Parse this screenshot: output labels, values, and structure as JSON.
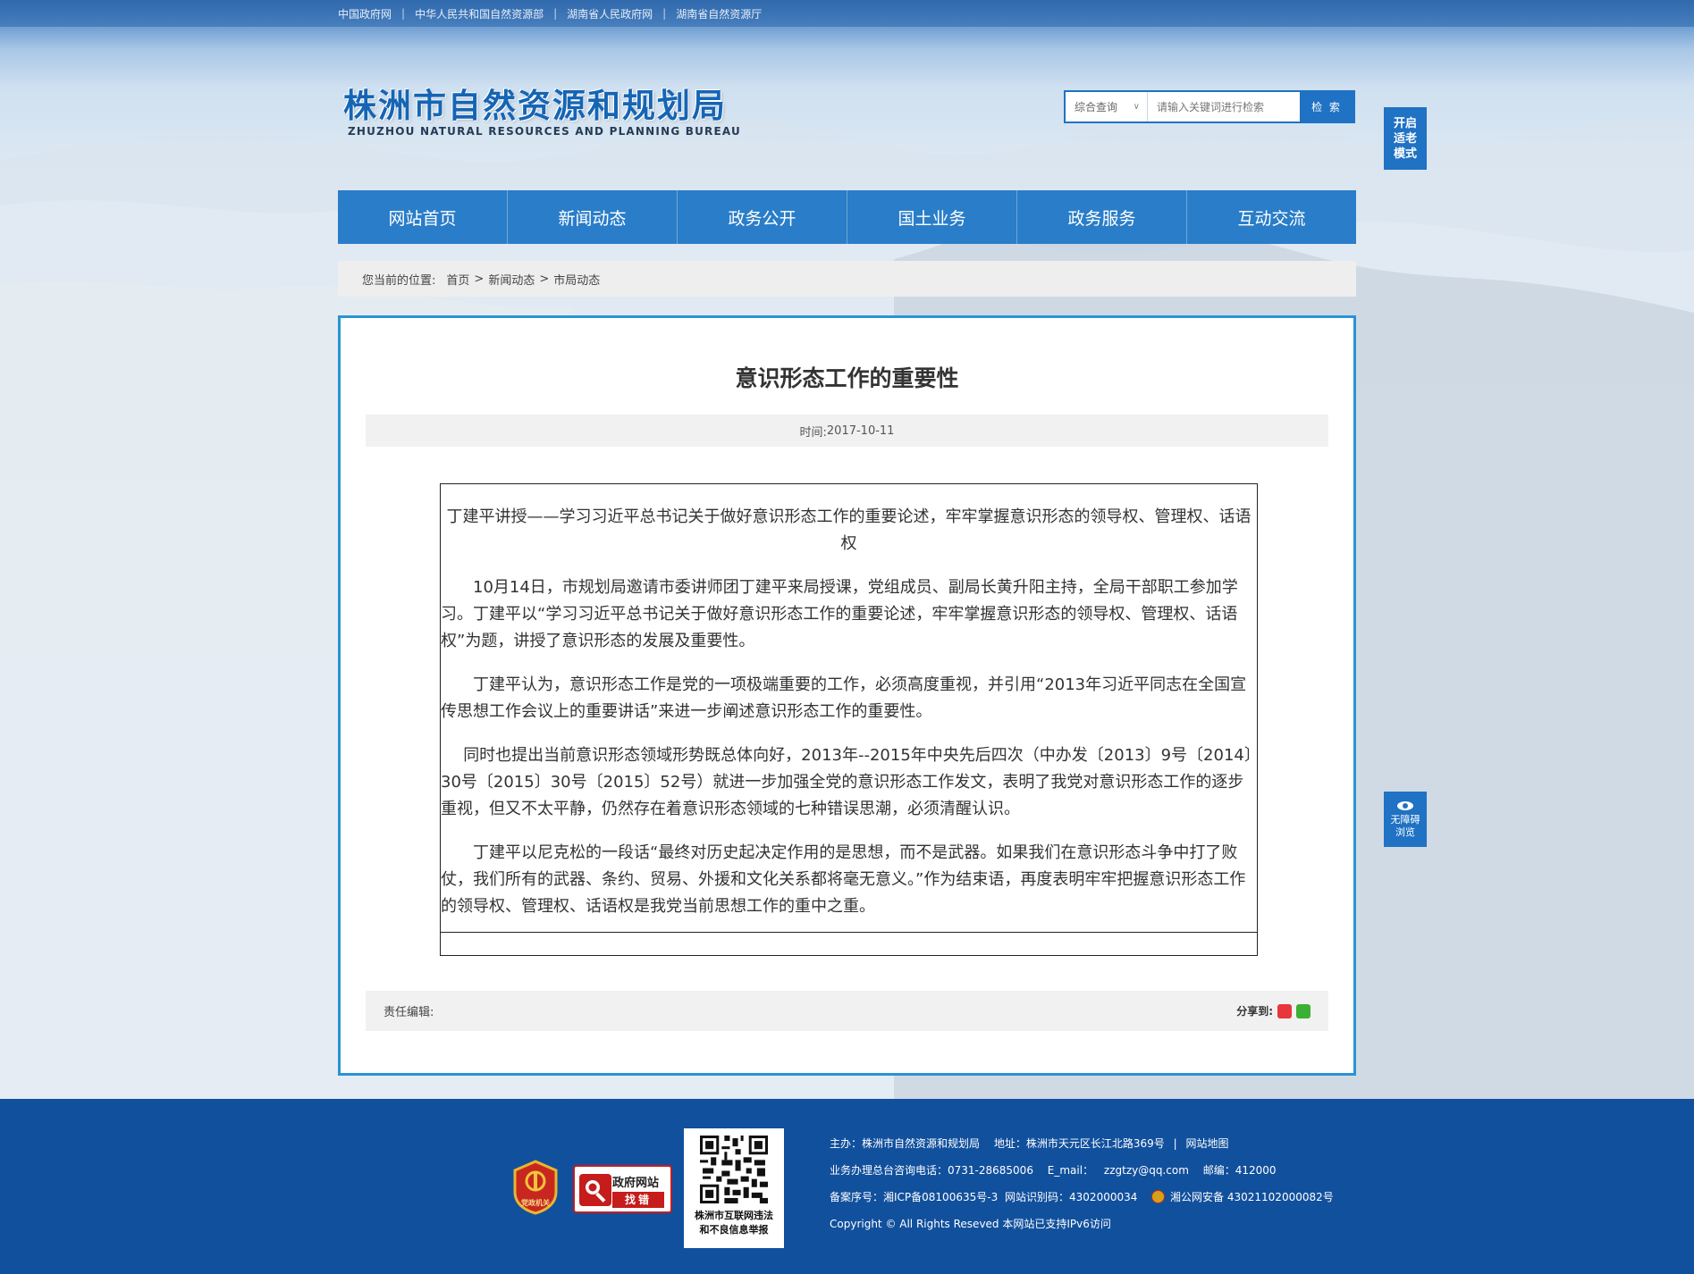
{
  "top_links": [
    "中国政府网",
    "中华人民共和国自然资源部",
    "湖南省人民政府网",
    "湖南省自然资源厅"
  ],
  "logo": {
    "cn": "株洲市自然资源和规划局",
    "en": "ZHUZHOU NATURAL RESOURCES AND PLANNING BUREAU"
  },
  "search": {
    "scope": "综合查询",
    "placeholder": "请输入关键词进行检索",
    "button": "检 索"
  },
  "side": {
    "elder_mode": [
      "开启",
      "适老",
      "模式"
    ],
    "accessibility": [
      "无障碍",
      "浏览"
    ]
  },
  "nav": [
    "网站首页",
    "新闻动态",
    "政务公开",
    "国土业务",
    "政务服务",
    "互动交流"
  ],
  "breadcrumb": {
    "label": "您当前的位置:",
    "items": [
      "首页",
      "新闻动态",
      "市局动态"
    ],
    "sep": ">"
  },
  "article": {
    "title": "意识形态工作的重要性",
    "date_label": "时间:",
    "date": "2017-10-11",
    "paragraphs": [
      "丁建平讲授——学习习近平总书记关于做好意识形态工作的重要论述，牢牢掌握意识形态的领导权、管理权、话语权",
      "10月14日，市规划局邀请市委讲师团丁建平来局授课，党组成员、副局长黄升阳主持，全局干部职工参加学习。丁建平以“学习习近平总书记关于做好意识形态工作的重要论述，牢牢掌握意识形态的领导权、管理权、话语权”为题，讲授了意识形态的发展及重要性。",
      "丁建平认为，意识形态工作是党的一项极端重要的工作，必须高度重视，并引用“2013年习近平同志在全国宣传思想工作会议上的重要讲话”来进一步阐述意识形态工作的重要性。",
      "同时也提出当前意识形态领域形势既总体向好，2013年--2015年中央先后四次（中办发〔2013〕9号〔2014〕30号〔2015〕30号〔2015〕52号）就进一步加强全党的意识形态工作发文，表明了我党对意识形态工作的逐步重视，但又不太平静，仍然存在着意识形态领域的七种错误思潮，必须清醒认识。",
      "丁建平以尼克松的一段话“最终对历史起决定作用的是思想，而不是武器。如果我们在意识形态斗争中打了败仗，我们所有的武器、条约、贸易、外援和文化关系都将毫无意义。”作为结束语，再度表明牢牢把握意识形态工作的领导权、管理权、话语权是我党当前思想工作的重中之重。"
    ],
    "editor_label": "责任编辑:",
    "share_label": "分享到:"
  },
  "footer": {
    "party_badge": "党政机关",
    "error_badge": {
      "line1": "政府网站",
      "line2": "找错"
    },
    "qr_caption": [
      "株洲市互联网违法",
      "和不良信息举报"
    ],
    "host": "主办：株洲市自然资源和规划局",
    "address": "地址：株洲市天元区长江北路369号",
    "sitemap": "网站地图",
    "hotline": "业务办理总台咨询电话：0731-28685006",
    "email_label": "E_mail：",
    "email": "zzgtzy@qq.com",
    "postcode": "邮编：412000",
    "icp": "备案序号：湘ICP备08100635号-3",
    "site_code": "网站识别码：4302000034",
    "police": "湘公网安备 43021102000082号",
    "copyright": "Copyright © All Rights Reseved 本网站已支持IPv6访问"
  },
  "colors": {
    "primary": "#2a7dc8",
    "panel_border": "#2a93d5",
    "footer_bg": "#11509d"
  }
}
